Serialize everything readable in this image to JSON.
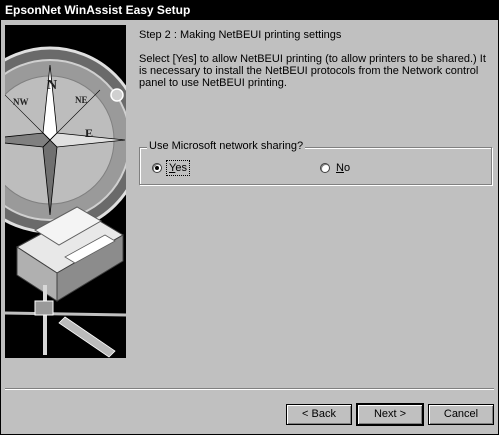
{
  "window": {
    "title": "EpsonNet WinAssist Easy Setup"
  },
  "step": {
    "title": "Step 2 : Making NetBEUI printing settings",
    "description": "Select [Yes] to allow NetBEUI printing (to allow printers to be shared.) It is necessary to install the NetBEUI protocols from the Network control panel to use NetBEUI printing."
  },
  "group": {
    "label": "Use Microsoft network sharing?",
    "options": {
      "yes": "Yes",
      "no": "No"
    },
    "selected": "Yes"
  },
  "buttons": {
    "back": "< Back",
    "next": "Next >",
    "cancel": "Cancel"
  },
  "colors": {
    "dialog_bg": "#c0c0c0",
    "titlebar_bg": "#000000",
    "titlebar_text": "#ffffff"
  }
}
